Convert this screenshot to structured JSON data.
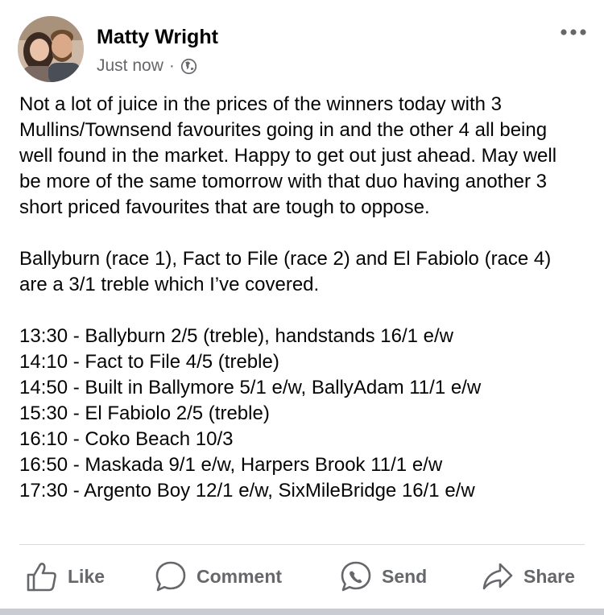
{
  "post": {
    "author": "Matty Wright",
    "timestamp": "Just now",
    "separator": "·",
    "privacy_icon": "globe-icon",
    "more_icon": "more-options-icon",
    "paragraphs": [
      "Not a lot of juice in the prices of the winners today with 3 Mullins/Townsend favourites going in and the other 4 all being well found in the market. Happy to get out just ahead. May well be more of the same tomorrow with that duo having another 3 short priced favourites that are tough to oppose.",
      "Ballyburn (race 1), Fact to File (race 2) and El Fabiolo (race 4) are a 3/1 treble which I’ve covered."
    ],
    "selections": [
      "13:30 - Ballyburn 2/5 (treble), handstands 16/1 e/w",
      "14:10 - Fact to File 4/5 (treble)",
      "14:50 - Built in Ballymore 5/1 e/w, BallyAdam 11/1 e/w",
      "15:30 - El Fabiolo 2/5 (treble)",
      "16:10 - Coko Beach 10/3",
      "16:50 - Maskada 9/1 e/w, Harpers Brook 11/1 e/w",
      "17:30 - Argento Boy 12/1 e/w, SixMileBridge 16/1 e/w"
    ]
  },
  "actions": {
    "like": "Like",
    "comment": "Comment",
    "send": "Send",
    "share": "Share"
  },
  "colors": {
    "text": "#050505",
    "secondary": "#65676b",
    "divider": "#d9d9d9"
  }
}
